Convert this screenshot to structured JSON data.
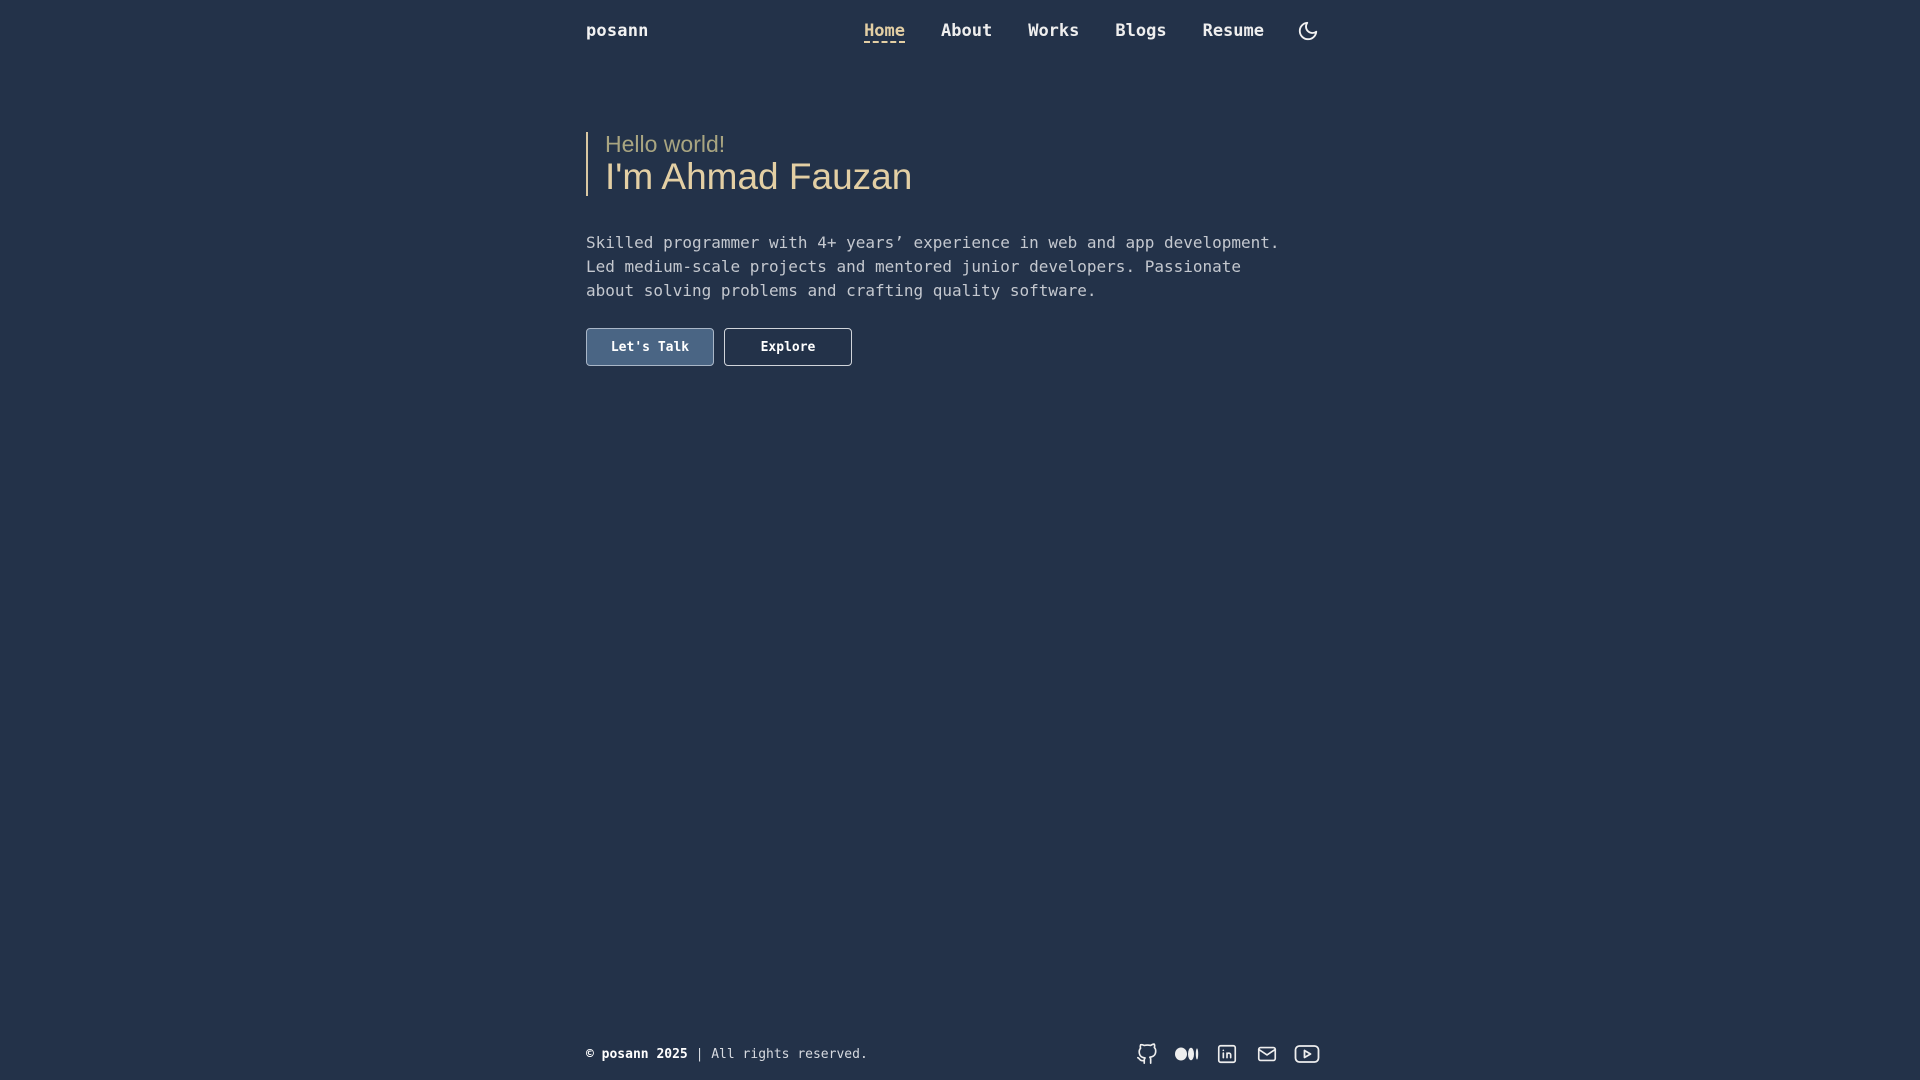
{
  "header": {
    "logo": "posann",
    "nav": [
      {
        "label": "Home",
        "active": true
      },
      {
        "label": "About"
      },
      {
        "label": "Works"
      },
      {
        "label": "Blogs"
      },
      {
        "label": "Resume"
      }
    ],
    "theme_icon": "moon-icon"
  },
  "hero": {
    "greeting": "Hello world!",
    "name": "I'm Ahmad Fauzan",
    "intro_lines": [
      "Skilled programmer with 4+ years’ experience in web and app development.",
      "Led medium-scale projects and mentored junior developers. Passionate",
      "about solving problems and crafting quality software."
    ],
    "primary_button": "Let's Talk",
    "secondary_button": "Explore"
  },
  "footer": {
    "copyright_symbol": "©",
    "brand_year": "posann 2025",
    "rights": "| All rights reserved.",
    "socials": [
      "github-icon",
      "medium-icon",
      "linkedin-icon",
      "mail-icon",
      "youtube-icon"
    ]
  },
  "colors": {
    "background": "#233249",
    "accent": "#e3cfa4",
    "greeting": "#a9a581",
    "primary_button": "#4a6584"
  }
}
